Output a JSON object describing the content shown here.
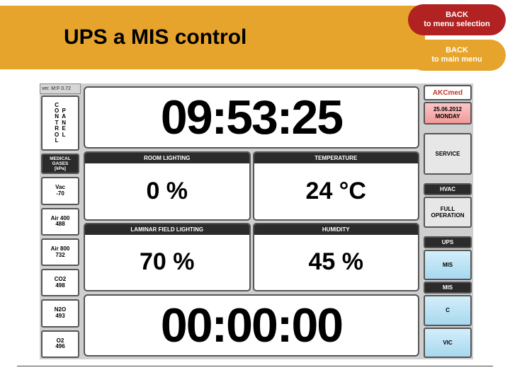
{
  "title": "UPS a MIS control",
  "back_menu_selection": {
    "l1": "BACK",
    "l2": "to  menu  selection"
  },
  "back_main_menu": {
    "l1": "BACK",
    "l2": "to main menu"
  },
  "version": "ver. M:F 0.72",
  "cp_left": [
    "C",
    "O",
    "N",
    "T",
    "R",
    "O",
    "L"
  ],
  "cp_right": [
    "P",
    "A",
    "N",
    "E",
    "L"
  ],
  "gases_header": {
    "l1": "MEDICAL",
    "l2": "GASES",
    "l3": "[kPa]"
  },
  "gases": [
    {
      "name": "Vac",
      "val": "-70"
    },
    {
      "name": "Air 400",
      "val": "488"
    },
    {
      "name": "Air 800",
      "val": "732"
    },
    {
      "name": "CO2",
      "val": "498"
    },
    {
      "name": "N2O",
      "val": "493"
    },
    {
      "name": "O2",
      "val": "496"
    }
  ],
  "clock": "09:53:25",
  "timer": "00:00:00",
  "env": [
    {
      "hdr": "ROOM LIGHTING",
      "val": "0 %"
    },
    {
      "hdr": "TEMPERATURE",
      "val": "24 °C"
    },
    {
      "hdr": "LAMINAR FIELD LIGHTING",
      "val": "70 %"
    },
    {
      "hdr": "HUMIDITY",
      "val": "45 %"
    }
  ],
  "logo": "AKCmed",
  "date": {
    "d": "25.06.2012",
    "dow": "MONDAY"
  },
  "right_buttons": {
    "service": "SERVICE",
    "hvac": "HVAC",
    "full_op": "FULL\nOPERATION",
    "ups_hdr": "UPS",
    "mis_btn": "MIS",
    "mis_hdr": "MIS",
    "c": "C",
    "vic": "VIC"
  }
}
